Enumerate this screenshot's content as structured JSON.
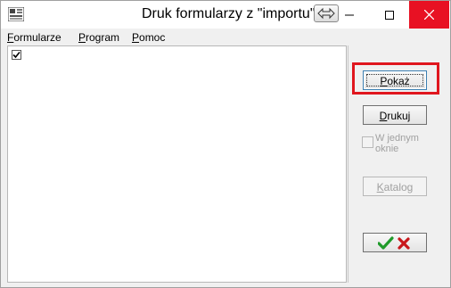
{
  "window": {
    "title": "Druk formularzy z \"importu\"",
    "icons": {
      "app": "app-icon",
      "title_swap": "swap-arrows-icon",
      "minimize": "minimize-icon",
      "maximize": "maximize-icon",
      "close": "close-icon"
    },
    "colors": {
      "close_bg": "#e81123"
    }
  },
  "menu": {
    "items": [
      "Formularze",
      "Program",
      "Pomoc"
    ]
  },
  "list": {
    "items": [
      {
        "checked": true,
        "label": ""
      }
    ]
  },
  "actions": {
    "show_label": "Pokaż",
    "print_label": "Drukuj",
    "one_window_label": "W jednym oknie",
    "one_window_checked": false,
    "catalog_label": "Katalog",
    "confirm_icon": "green-check-icon",
    "cancel_icon": "red-x-icon"
  },
  "highlight": {
    "color": "#e0161e",
    "target": "Pokaż"
  }
}
